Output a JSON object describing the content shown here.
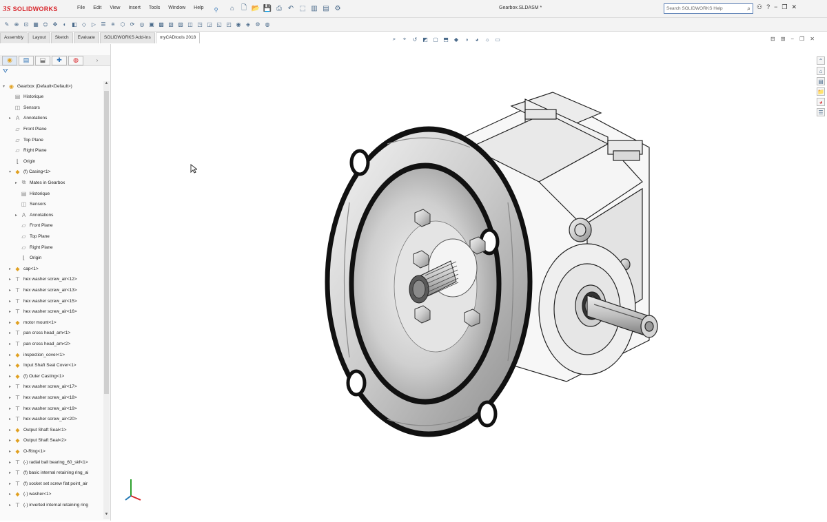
{
  "app": {
    "logo_ds": "3S",
    "logo_name": "SOLIDWORKS",
    "document_title": "Gearbox.SLDASM *",
    "search_placeholder": "Search SOLIDWORKS Help"
  },
  "menu": [
    "File",
    "Edit",
    "View",
    "Insert",
    "Tools",
    "Window",
    "Help"
  ],
  "tabs": [
    {
      "label": "Assembly",
      "active": false
    },
    {
      "label": "Layout",
      "active": false
    },
    {
      "label": "Sketch",
      "active": false
    },
    {
      "label": "Evaluate",
      "active": false
    },
    {
      "label": "SOLIDWORKS Add-Ins",
      "active": false
    },
    {
      "label": "myCADtools 2018",
      "active": true
    }
  ],
  "feature_tree": [
    {
      "label": "Gearbox  (Default<Default>)",
      "icon": "assembly-icon",
      "indent": 0,
      "expand": "-"
    },
    {
      "label": "Historique",
      "icon": "history-icon",
      "indent": 1,
      "expand": ""
    },
    {
      "label": "Sensors",
      "icon": "sensor-icon",
      "indent": 1,
      "expand": ""
    },
    {
      "label": "Annotations",
      "icon": "annotation-icon",
      "indent": 1,
      "expand": "+"
    },
    {
      "label": "Front Plane",
      "icon": "plane-icon",
      "indent": 1,
      "expand": ""
    },
    {
      "label": "Top Plane",
      "icon": "plane-icon",
      "indent": 1,
      "expand": ""
    },
    {
      "label": "Right Plane",
      "icon": "plane-icon",
      "indent": 1,
      "expand": ""
    },
    {
      "label": "Origin",
      "icon": "origin-icon",
      "indent": 1,
      "expand": ""
    },
    {
      "label": "(f) Casing<1>",
      "icon": "part-icon",
      "indent": 1,
      "expand": "-"
    },
    {
      "label": "Mates in Gearbox",
      "icon": "mates-icon",
      "indent": 2,
      "expand": "+"
    },
    {
      "label": "Historique",
      "icon": "history-icon",
      "indent": 2,
      "expand": ""
    },
    {
      "label": "Sensors",
      "icon": "sensor-icon",
      "indent": 2,
      "expand": ""
    },
    {
      "label": "Annotations",
      "icon": "annotation-icon",
      "indent": 2,
      "expand": "+"
    },
    {
      "label": "Front Plane",
      "icon": "plane-icon",
      "indent": 2,
      "expand": ""
    },
    {
      "label": "Top Plane",
      "icon": "plane-icon",
      "indent": 2,
      "expand": ""
    },
    {
      "label": "Right Plane",
      "icon": "plane-icon",
      "indent": 2,
      "expand": ""
    },
    {
      "label": "Origin",
      "icon": "origin-icon",
      "indent": 2,
      "expand": ""
    },
    {
      "label": "cap<1>",
      "icon": "part-icon",
      "indent": 1,
      "expand": "+"
    },
    {
      "label": "hex washer screw_air<12>",
      "icon": "screw-icon",
      "indent": 1,
      "expand": "+"
    },
    {
      "label": "hex washer screw_air<13>",
      "icon": "screw-icon",
      "indent": 1,
      "expand": "+"
    },
    {
      "label": "hex washer screw_air<15>",
      "icon": "screw-icon",
      "indent": 1,
      "expand": "+"
    },
    {
      "label": "hex washer screw_air<16>",
      "icon": "screw-icon",
      "indent": 1,
      "expand": "+"
    },
    {
      "label": "motor mount<1>",
      "icon": "part-icon",
      "indent": 1,
      "expand": "+"
    },
    {
      "label": "pan cross head_am<1>",
      "icon": "screw-icon",
      "indent": 1,
      "expand": "+"
    },
    {
      "label": "pan cross head_am<2>",
      "icon": "screw-icon",
      "indent": 1,
      "expand": "+"
    },
    {
      "label": "inspection_cover<1>",
      "icon": "part-icon",
      "indent": 1,
      "expand": "+"
    },
    {
      "label": "Input Shaft Seal Cover<1>",
      "icon": "part-icon",
      "indent": 1,
      "expand": "+"
    },
    {
      "label": "(f) Outer Casting<1>",
      "icon": "part-icon",
      "indent": 1,
      "expand": "+"
    },
    {
      "label": "hex washer screw_air<17>",
      "icon": "screw-icon",
      "indent": 1,
      "expand": "+"
    },
    {
      "label": "hex washer screw_air<18>",
      "icon": "screw-icon",
      "indent": 1,
      "expand": "+"
    },
    {
      "label": "hex washer screw_air<19>",
      "icon": "screw-icon",
      "indent": 1,
      "expand": "+"
    },
    {
      "label": "hex washer screw_air<20>",
      "icon": "screw-icon",
      "indent": 1,
      "expand": "+"
    },
    {
      "label": "Output Shaft Seal<1>",
      "icon": "part-icon",
      "indent": 1,
      "expand": "+"
    },
    {
      "label": "Output Shaft Seal<2>",
      "icon": "part-icon",
      "indent": 1,
      "expand": "+"
    },
    {
      "label": "O-Ring<1>",
      "icon": "part-icon",
      "indent": 1,
      "expand": "+"
    },
    {
      "label": "(-) radial ball bearing_60_skf<1>",
      "icon": "screw-icon",
      "indent": 1,
      "expand": "+"
    },
    {
      "label": "(f) basic internal retaining ring_ai",
      "icon": "screw-icon",
      "indent": 1,
      "expand": "+"
    },
    {
      "label": "(f) socket set screw flat point_air",
      "icon": "screw-icon",
      "indent": 1,
      "expand": "+"
    },
    {
      "label": "(-) washer<1>",
      "icon": "part-icon",
      "indent": 1,
      "expand": "+"
    },
    {
      "label": "(-) inverted internal retaining ring",
      "icon": "screw-icon",
      "indent": 1,
      "expand": "+"
    }
  ],
  "colors": {
    "brand_red": "#d8262c",
    "accent_blue": "#2a6fb3",
    "part_yellow": "#e0a020"
  }
}
